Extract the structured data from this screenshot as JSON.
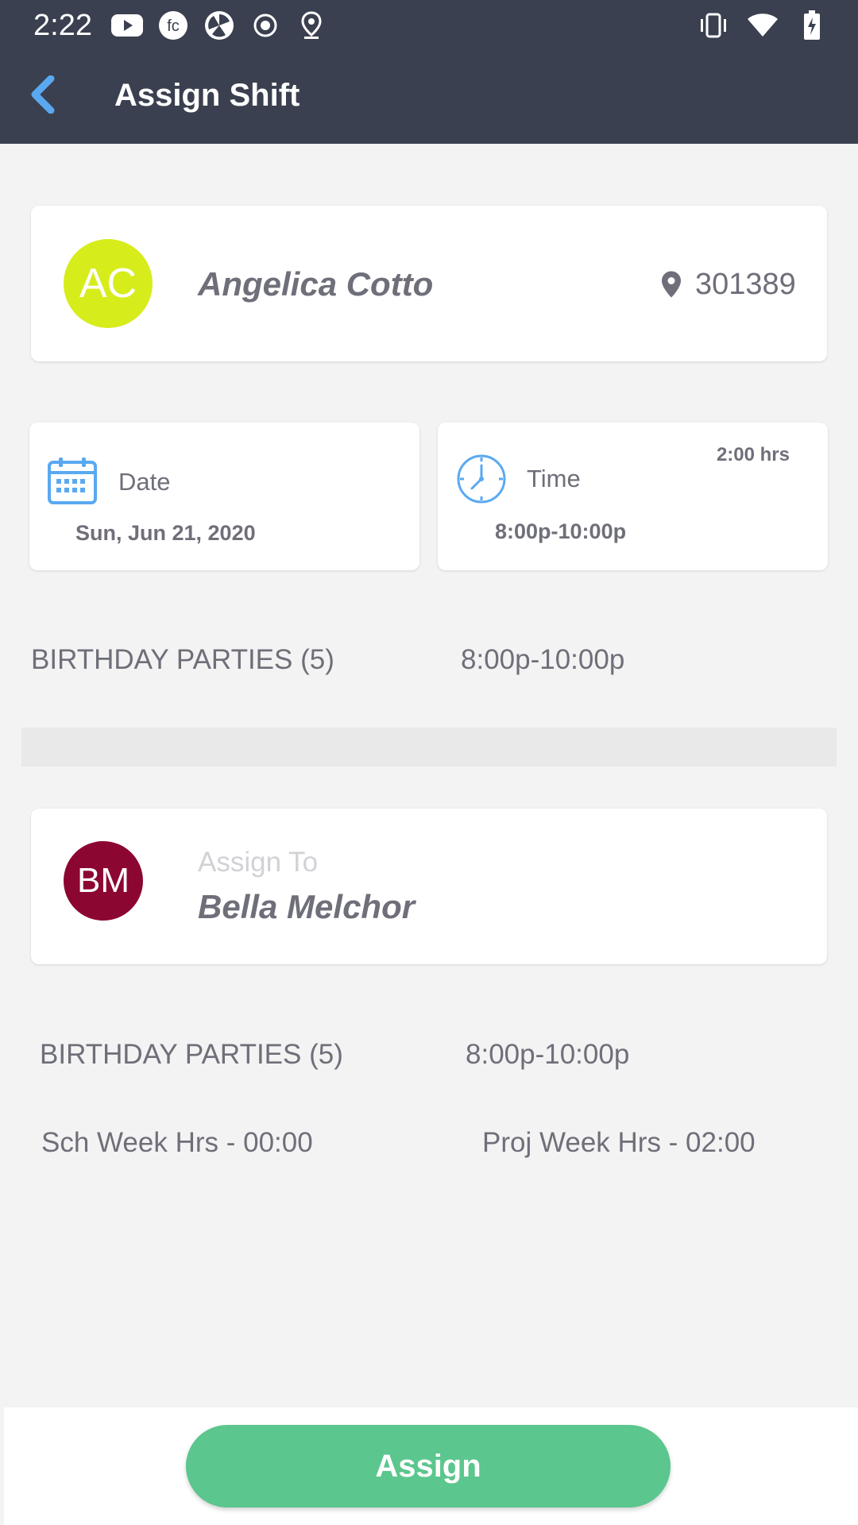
{
  "status_bar": {
    "time": "2:22",
    "left_icons": [
      "youtube-icon",
      "fc-app-icon",
      "aperture-app-icon",
      "record-icon",
      "location-pin-icon"
    ],
    "right_icons": [
      "vibrate-icon",
      "wifi-icon",
      "battery-charging-icon"
    ]
  },
  "header": {
    "title": "Assign Shift",
    "back_icon": "chevron-left-icon",
    "background": "#3a404f",
    "back_color": "#5aa9f0"
  },
  "employee": {
    "initials": "AC",
    "avatar_color": "#d7ec1b",
    "name": "Angelica Cotto",
    "location_code": "301389"
  },
  "shift_date": {
    "label": "Date",
    "value": "Sun, Jun 21, 2020",
    "icon": "calendar-icon"
  },
  "shift_time": {
    "label": "Time",
    "value": "8:00p-10:00p",
    "duration": "2:00 hrs",
    "icon": "clock-icon"
  },
  "shift_summary": {
    "position": "BIRTHDAY PARTIES (5)",
    "time": "8:00p-10:00p"
  },
  "assignee": {
    "label": "Assign To",
    "initials": "BM",
    "avatar_color": "#8c0632",
    "name": "Bella Melchor",
    "position": "BIRTHDAY PARTIES (5)",
    "time": "8:00p-10:00p",
    "sch_week_hrs": "Sch Week Hrs - 00:00",
    "proj_week_hrs": "Proj Week Hrs - 02:00"
  },
  "actions": {
    "assign_label": "Assign",
    "assign_color": "#5bc68d"
  }
}
